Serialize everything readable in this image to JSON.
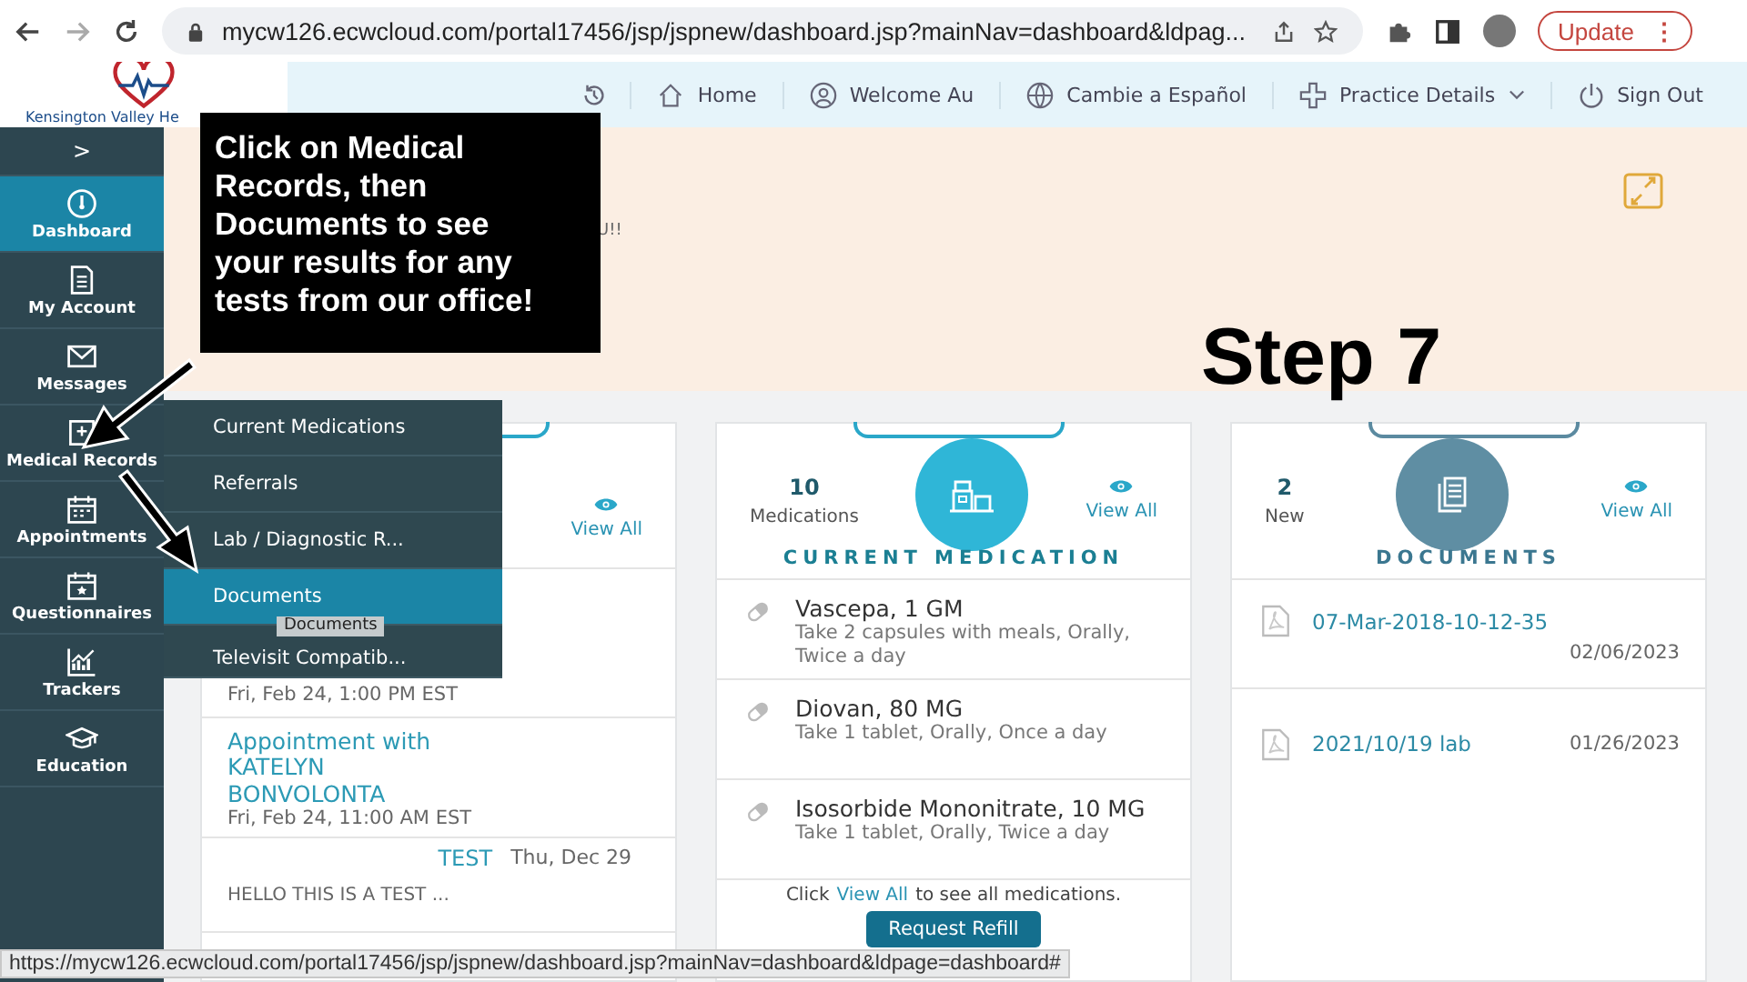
{
  "browser": {
    "url": "mycw126.ecwcloud.com/portal17456/jsp/jspnew/dashboard.jsp?mainNav=dashboard&ldpag...",
    "update_label": "Update",
    "menu_glyph": "⋮"
  },
  "header": {
    "logo_text": "Kensington Valley He",
    "nav": [
      {
        "label": "Home",
        "dropdown": false
      },
      {
        "label": "Welcome Au",
        "dropdown": false
      },
      {
        "label": "Cambie a Español",
        "dropdown": false
      },
      {
        "label": "Practice Details",
        "dropdown": true
      },
      {
        "label": "Sign Out",
        "dropdown": false
      }
    ]
  },
  "sidebar": {
    "toggle": ">",
    "items": [
      {
        "label": "Dashboard",
        "selected": true
      },
      {
        "label": "My Account",
        "selected": false
      },
      {
        "label": "Messages",
        "selected": false
      },
      {
        "label": "Medical Records",
        "selected": false
      },
      {
        "label": "Appointments",
        "selected": false
      },
      {
        "label": "Questionnaires",
        "selected": false
      },
      {
        "label": "Trackers",
        "selected": false
      },
      {
        "label": "Education",
        "selected": false
      }
    ]
  },
  "flyout": {
    "tooltip": "Documents",
    "items": [
      {
        "label": "Current Medications",
        "selected": false
      },
      {
        "label": "Referrals",
        "selected": false
      },
      {
        "label": "Lab / Diagnostic R...",
        "selected": false
      },
      {
        "label": "Documents",
        "selected": true
      },
      {
        "label": "Televisit Compatib...",
        "selected": false
      }
    ]
  },
  "banner": {
    "text": "U!!"
  },
  "appointments_card": {
    "view_all": "View All",
    "rows": [
      {
        "kind": "appointment",
        "date": "Fri, Feb 24, 1:00 PM EST"
      },
      {
        "kind": "appointment",
        "title": "Appointment with KATELYN BONVOLONTA",
        "date": "Fri, Feb 24, 11:00 AM EST"
      },
      {
        "kind": "message",
        "subject": "TEST",
        "date": "Thu, Dec 29",
        "preview": "HELLO THIS IS A TEST ..."
      }
    ]
  },
  "medication_card": {
    "count": "10",
    "count_label": "Medications",
    "view_all": "View All",
    "title": "CURRENT MEDICATION",
    "items": [
      {
        "name": "Vascepa, 1 GM",
        "instructions": "Take 2 capsules with meals, Orally, Twice a day"
      },
      {
        "name": "Diovan, 80 MG",
        "instructions": "Take 1 tablet, Orally, Once a day"
      },
      {
        "name": "Isosorbide Mononitrate, 10 MG",
        "instructions": "Take 1 tablet, Orally, Twice a day"
      }
    ],
    "footer_before": "Click",
    "footer_link": "View All",
    "footer_after": "to see all medications.",
    "button": "Request Refill"
  },
  "documents_card": {
    "count": "2",
    "count_label": "New",
    "view_all": "View All",
    "title": "DOCUMENTS",
    "items": [
      {
        "name": "07-Mar-2018-10-12-35",
        "date": "02/06/2023"
      },
      {
        "name": "2021/10/19 lab",
        "date": "01/26/2023"
      }
    ]
  },
  "status_bar": {
    "url": "https://mycw126.ecwcloud.com/portal17456/jsp/jspnew/dashboard.jsp?mainNav=dashboard&ldpage=dashboard#"
  },
  "annotation": {
    "callout": "Click on Medical Records, then Documents to see your results for any tests from our office!",
    "step": "Step 7"
  }
}
